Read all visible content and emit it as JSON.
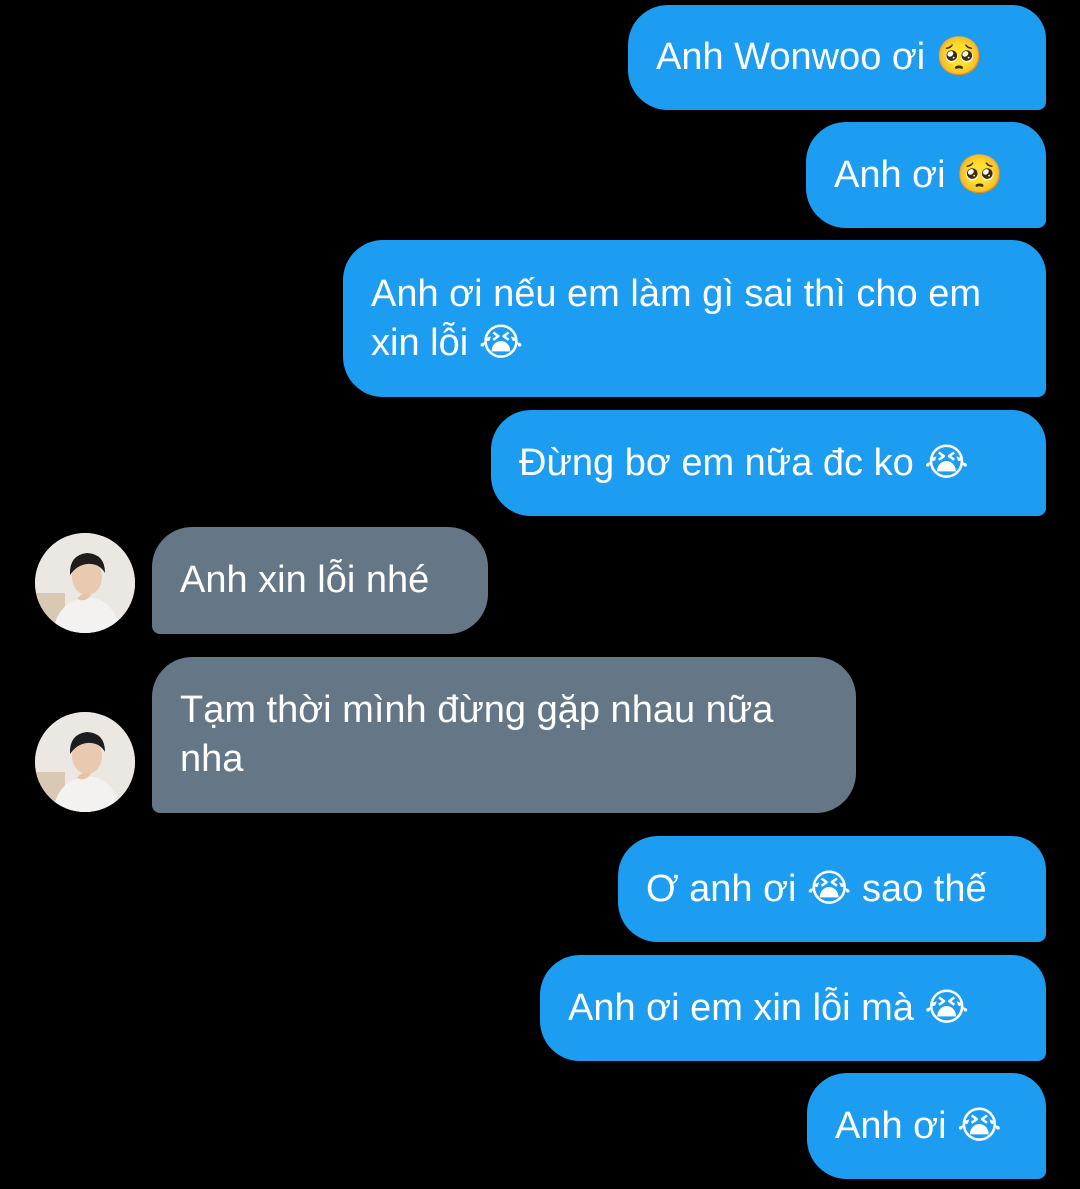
{
  "conversation": {
    "messages": [
      {
        "side": "sent",
        "text": "Anh Wonwoo ơi 🥺"
      },
      {
        "side": "sent",
        "text": "Anh ơi 🥺"
      },
      {
        "side": "sent",
        "text": "Anh ơi nếu em làm gì sai thì cho em xin lỗi 😭"
      },
      {
        "side": "sent",
        "text": "Đừng bơ em nữa đc ko 😭"
      },
      {
        "side": "received",
        "text": "Anh xin lỗi nhé"
      },
      {
        "side": "received",
        "text": "Tạm thời mình đừng gặp nhau nữa nha"
      },
      {
        "side": "sent",
        "text": "Ơ anh ơi 😭 sao thế"
      },
      {
        "side": "sent",
        "text": "Anh ơi em xin lỗi mà 😭"
      },
      {
        "side": "sent",
        "text": "Anh ơi 😭"
      }
    ]
  },
  "colors": {
    "background": "#000000",
    "sent_bubble": "#1c9df2",
    "received_bubble": "#657786",
    "text": "#ffffff"
  },
  "icons": {
    "avatar": "contact-avatar-photo"
  }
}
